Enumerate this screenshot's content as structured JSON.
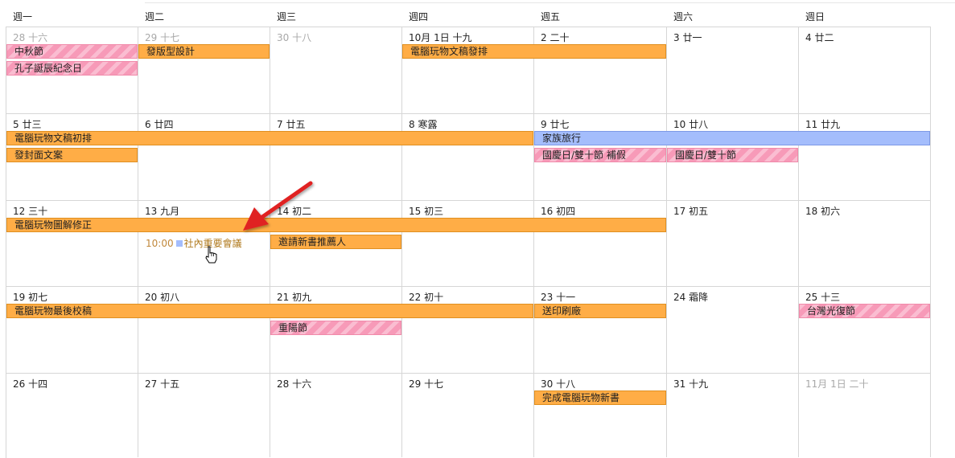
{
  "weekdays": [
    "週一",
    "週二",
    "週三",
    "週四",
    "週五",
    "週六",
    "週日"
  ],
  "weeks": [
    {
      "days": [
        {
          "label": "28 十六",
          "dim": true
        },
        {
          "label": "29 十七",
          "dim": true
        },
        {
          "label": "30 十八",
          "dim": true
        },
        {
          "label": "10月 1日 十九",
          "dim": false
        },
        {
          "label": "2 二十",
          "dim": false
        },
        {
          "label": "3 廿一",
          "dim": false
        },
        {
          "label": "4 廿二",
          "dim": false
        }
      ]
    },
    {
      "days": [
        {
          "label": "5 廿三",
          "dim": false
        },
        {
          "label": "6 廿四",
          "dim": false
        },
        {
          "label": "7 廿五",
          "dim": false
        },
        {
          "label": "8 寒露",
          "dim": false
        },
        {
          "label": "9 廿七",
          "dim": false
        },
        {
          "label": "10 廿八",
          "dim": false
        },
        {
          "label": "11 廿九",
          "dim": false
        }
      ]
    },
    {
      "days": [
        {
          "label": "12 三十",
          "dim": false
        },
        {
          "label": "13 九月",
          "dim": false
        },
        {
          "label": "14 初二",
          "dim": false
        },
        {
          "label": "15 初三",
          "dim": false
        },
        {
          "label": "16 初四",
          "dim": false
        },
        {
          "label": "17 初五",
          "dim": false
        },
        {
          "label": "18 初六",
          "dim": false
        }
      ]
    },
    {
      "days": [
        {
          "label": "19 初七",
          "dim": false
        },
        {
          "label": "20 初八",
          "dim": false
        },
        {
          "label": "21 初九",
          "dim": false
        },
        {
          "label": "22 初十",
          "dim": false
        },
        {
          "label": "23 十一",
          "dim": false
        },
        {
          "label": "24 霜降",
          "dim": false
        },
        {
          "label": "25 十三",
          "dim": false
        }
      ]
    },
    {
      "days": [
        {
          "label": "26 十四",
          "dim": false
        },
        {
          "label": "27 十五",
          "dim": false
        },
        {
          "label": "28 十六",
          "dim": false
        },
        {
          "label": "29 十七",
          "dim": false
        },
        {
          "label": "30 十八",
          "dim": false
        },
        {
          "label": "31 十九",
          "dim": false
        },
        {
          "label": "11月 1日 二十",
          "dim": true
        }
      ]
    }
  ],
  "events": [
    {
      "title": "中秋節",
      "color": "pink",
      "week": 0,
      "start": 0,
      "span": 1,
      "slot": 0
    },
    {
      "title": "孔子誕辰紀念日",
      "color": "pink",
      "week": 0,
      "start": 0,
      "span": 1,
      "slot": 1
    },
    {
      "title": "發版型設計",
      "color": "orange",
      "week": 0,
      "start": 1,
      "span": 1,
      "slot": 0
    },
    {
      "title": "電腦玩物文稿發排",
      "color": "orange",
      "week": 0,
      "start": 3,
      "span": 2,
      "slot": 0
    },
    {
      "title": "電腦玩物文稿初排",
      "color": "orange",
      "week": 1,
      "start": 0,
      "span": 4,
      "slot": 0
    },
    {
      "title": "發封面文案",
      "color": "orange",
      "week": 1,
      "start": 0,
      "span": 1,
      "slot": 1
    },
    {
      "title": "家族旅行",
      "color": "blue",
      "week": 1,
      "start": 4,
      "span": 3,
      "slot": 0
    },
    {
      "title": "國慶日/雙十節 補假",
      "color": "pink",
      "week": 1,
      "start": 4,
      "span": 1,
      "slot": 1
    },
    {
      "title": "國慶日/雙十節",
      "color": "pink",
      "week": 1,
      "start": 5,
      "span": 1,
      "slot": 1
    },
    {
      "title": "電腦玩物圖解修正",
      "color": "orange",
      "week": 2,
      "start": 0,
      "span": 5,
      "slot": 0
    },
    {
      "title": "邀請新書推薦人",
      "color": "orange",
      "week": 2,
      "start": 2,
      "span": 1,
      "slot": 1
    },
    {
      "title": "電腦玩物最後校稿",
      "color": "orange",
      "week": 3,
      "start": 0,
      "span": 4,
      "slot": 0
    },
    {
      "title": "重陽節",
      "color": "pink",
      "week": 3,
      "start": 2,
      "span": 1,
      "slot": 1
    },
    {
      "title": "送印刷廠",
      "color": "orange",
      "week": 3,
      "start": 4,
      "span": 1,
      "slot": 0
    },
    {
      "title": "台灣光復節",
      "color": "pink",
      "week": 3,
      "start": 6,
      "span": 1,
      "slot": 0
    },
    {
      "title": "完成電腦玩物新書",
      "color": "orange",
      "week": 4,
      "start": 4,
      "span": 1,
      "slot": 0
    }
  ],
  "timed_event": {
    "time": "10:00",
    "title": "社內重要會議",
    "week": 2,
    "day": 1,
    "slot": 1
  },
  "colors": {
    "orange": "#ffad46",
    "blue": "#a4bdfc",
    "pink": "#f79ab8",
    "annotation_arrow": "#e02020"
  }
}
